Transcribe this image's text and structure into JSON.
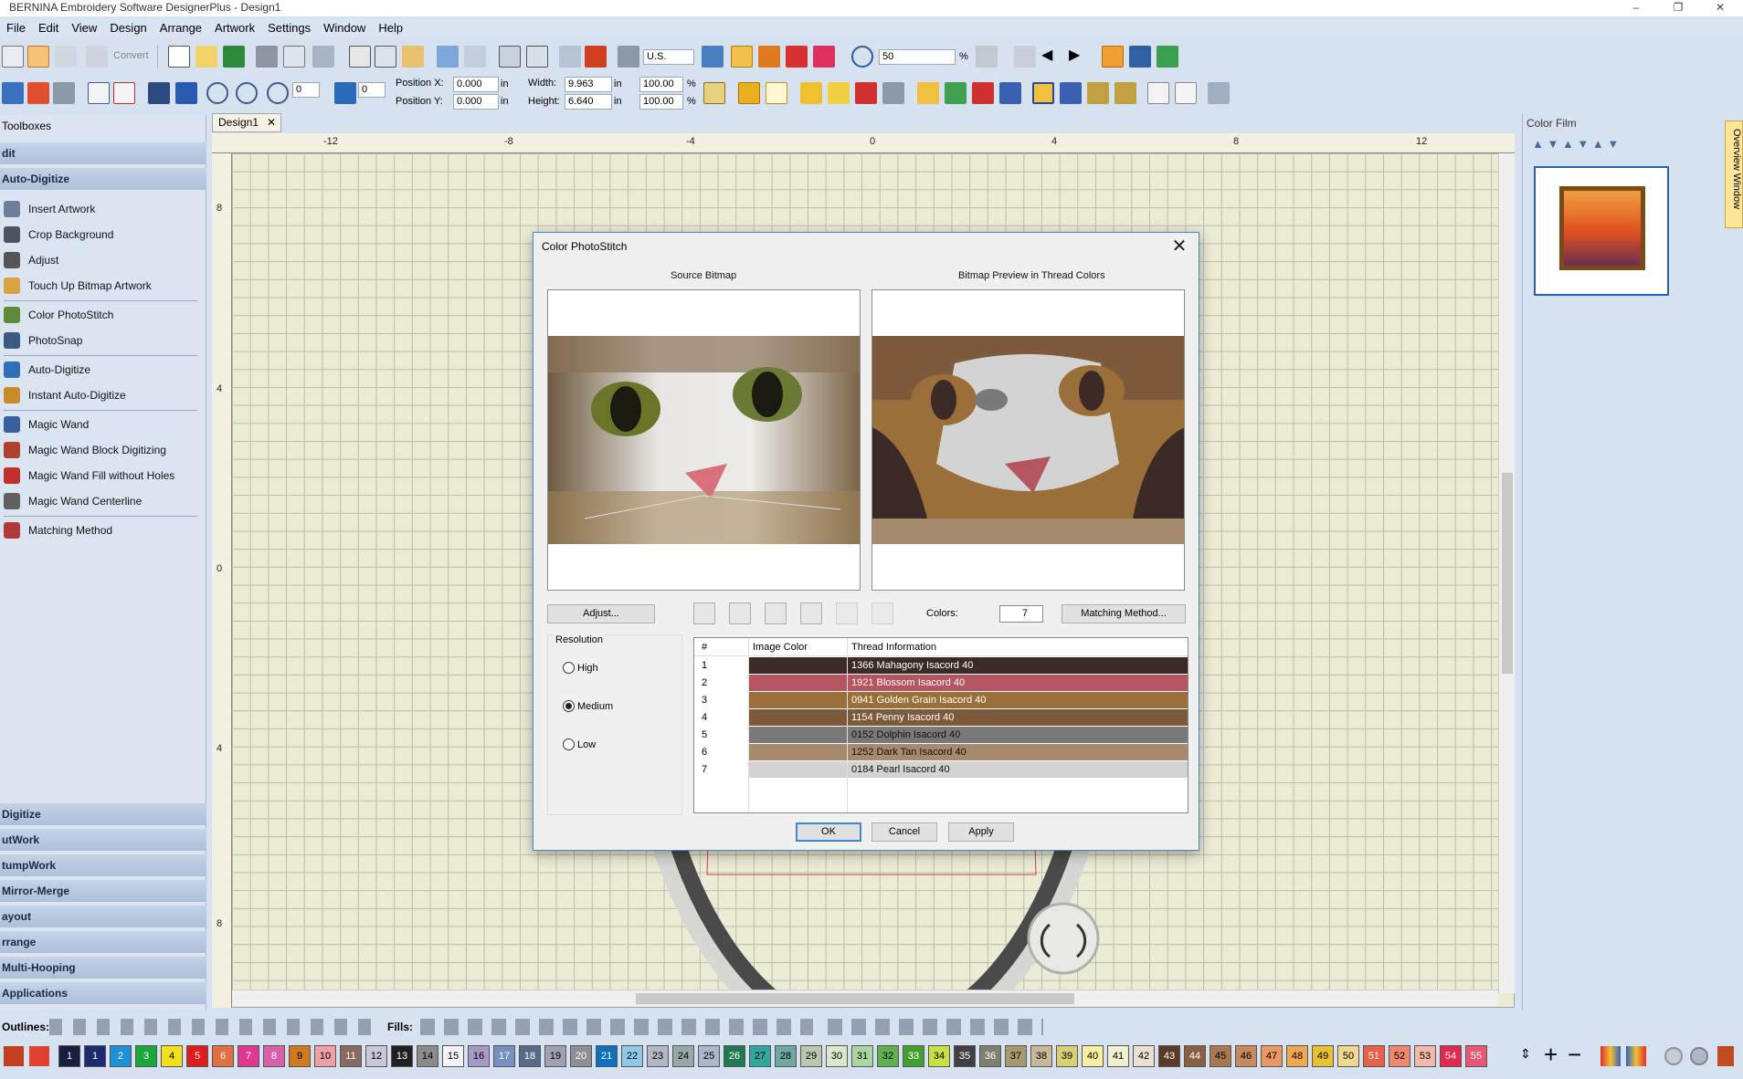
{
  "window": {
    "title": "BERNINA Embroidery Software DesignerPlus - Design1",
    "min": "–",
    "max": "❐",
    "close": "✕"
  },
  "menu": [
    "File",
    "Edit",
    "View",
    "Design",
    "Arrange",
    "Artwork",
    "Settings",
    "Window",
    "Help"
  ],
  "toolbar1": {
    "convert": "Convert",
    "units": "U.S.",
    "zoom": "50",
    "zoom_unit": "%"
  },
  "toolbar2": {
    "rotate1": "0",
    "rotate2": "0",
    "pos_x_label": "Position X:",
    "pos_x": "0.000",
    "pos_y_label": "Position Y:",
    "pos_y": "0.000",
    "unit_in": "in",
    "width_label": "Width:",
    "width": "9.963",
    "height_label": "Height:",
    "height": "6.640",
    "width_pct": "100.00",
    "height_pct": "100.00",
    "pct": "%"
  },
  "toolboxes": {
    "title": "Toolboxes",
    "sections_top": [
      "dit",
      "Auto-Digitize"
    ],
    "items": [
      {
        "label": "Insert Artwork",
        "icon": "insert-artwork-icon",
        "color": "#6b7f9a"
      },
      {
        "label": "Crop Background",
        "icon": "crop-icon",
        "color": "#4a5560"
      },
      {
        "label": "Adjust",
        "icon": "adjust-icon",
        "color": "#555"
      },
      {
        "label": "Touch Up Bitmap Artwork",
        "icon": "pencil-icon",
        "color": "#d9a441"
      },
      {
        "label": "Color PhotoStitch",
        "icon": "photostitch-icon",
        "color": "#5c8c3a"
      },
      {
        "label": "PhotoSnap",
        "icon": "camera-icon",
        "color": "#3c5a80"
      },
      {
        "label": "Auto-Digitize",
        "icon": "auto-digitize-icon",
        "color": "#2f6fb8"
      },
      {
        "label": "Instant Auto-Digitize",
        "icon": "instant-digitize-icon",
        "color": "#c98a2a"
      },
      {
        "label": "Magic Wand",
        "icon": "magic-wand-icon",
        "color": "#3a5fa0"
      },
      {
        "label": "Magic Wand Block Digitizing",
        "icon": "wand-block-icon",
        "color": "#b04030"
      },
      {
        "label": "Magic Wand Fill without Holes",
        "icon": "wand-fill-icon",
        "color": "#c0302a"
      },
      {
        "label": "Magic Wand Centerline",
        "icon": "wand-centerline-icon",
        "color": "#606060"
      },
      {
        "label": "Matching Method",
        "icon": "matching-method-icon",
        "color": "#b03a3a"
      }
    ],
    "sections_bottom": [
      "Digitize",
      "utWork",
      "tumpWork",
      "Mirror-Merge",
      "ayout",
      "rrange",
      "Multi-Hooping",
      "Applications"
    ]
  },
  "document": {
    "tab": "Design1",
    "tab_close": "✕",
    "ruler_top": [
      "-12",
      "-8",
      "-4",
      "0",
      "4",
      "8",
      "12"
    ],
    "ruler_left": [
      "8",
      "4",
      "0",
      "4",
      "8"
    ]
  },
  "color_film": {
    "title": "Color Film",
    "overview": "Overview Window"
  },
  "dialog": {
    "title": "Color PhotoStitch",
    "close": "✕",
    "source_title": "Source Bitmap",
    "preview_title": "Bitmap Preview in Thread Colors",
    "adjust": "Adjust...",
    "colors_label": "Colors:",
    "colors_value": "7",
    "matching": "Matching Method...",
    "resolution_title": "Resolution",
    "resolution": [
      {
        "label": "High",
        "selected": false
      },
      {
        "label": "Medium",
        "selected": true
      },
      {
        "label": "Low",
        "selected": false
      }
    ],
    "table_headers": [
      "#",
      "Image Color",
      "Thread Information"
    ],
    "threads": [
      {
        "n": "1",
        "info": "1366 Mahagony Isacord 40",
        "color": "#3b2a25",
        "text": "#ffffff"
      },
      {
        "n": "2",
        "info": "1921 Blossom Isacord 40",
        "color": "#b55560",
        "text": "#ffffff"
      },
      {
        "n": "3",
        "info": "0941 Golden Grain Isacord 40",
        "color": "#9a6f3a",
        "text": "#ffffff"
      },
      {
        "n": "4",
        "info": "1154 Penny Isacord 40",
        "color": "#7d5a3c",
        "text": "#ffffff"
      },
      {
        "n": "5",
        "info": "0152 Dolphin Isacord 40",
        "color": "#7a7878",
        "text": "#111111"
      },
      {
        "n": "6",
        "info": "1252 Dark Tan Isacord 40",
        "color": "#a68a6c",
        "text": "#111111"
      },
      {
        "n": "7",
        "info": "0184 Pearl Isacord 40",
        "color": "#d3d3d3",
        "text": "#111111"
      }
    ],
    "ok": "OK",
    "cancel": "Cancel",
    "apply": "Apply"
  },
  "bottom": {
    "outlines_label": "Outlines:",
    "fills_label": "Fills:",
    "palette": [
      {
        "n": "1",
        "c": "#1c1c3c",
        "t": "#fff"
      },
      {
        "n": "1",
        "c": "#1c2a6e",
        "t": "#fff"
      },
      {
        "n": "2",
        "c": "#1e90d8",
        "t": "#fff"
      },
      {
        "n": "3",
        "c": "#1aa63a",
        "t": "#fff"
      },
      {
        "n": "4",
        "c": "#f2e01c",
        "t": "#000"
      },
      {
        "n": "5",
        "c": "#e01c1c",
        "t": "#fff"
      },
      {
        "n": "6",
        "c": "#e07040",
        "t": "#fff"
      },
      {
        "n": "7",
        "c": "#e0388c",
        "t": "#fff"
      },
      {
        "n": "8",
        "c": "#d860a8",
        "t": "#fff"
      },
      {
        "n": "9",
        "c": "#d07a20",
        "t": "#000"
      },
      {
        "n": "10",
        "c": "#f0a0a8",
        "t": "#000"
      },
      {
        "n": "11",
        "c": "#8a6a60",
        "t": "#fff"
      },
      {
        "n": "12",
        "c": "#c8c8d8",
        "t": "#000"
      },
      {
        "n": "13",
        "c": "#202020",
        "t": "#fff"
      },
      {
        "n": "14",
        "c": "#8a8a8a",
        "t": "#000"
      },
      {
        "n": "15",
        "c": "#f4f4f4",
        "t": "#000"
      },
      {
        "n": "16",
        "c": "#a898c8",
        "t": "#000"
      },
      {
        "n": "17",
        "c": "#7890c0",
        "t": "#fff"
      },
      {
        "n": "18",
        "c": "#5a6a8a",
        "t": "#fff"
      },
      {
        "n": "19",
        "c": "#a0a0b0",
        "t": "#000"
      },
      {
        "n": "20",
        "c": "#8c9090",
        "t": "#fff"
      },
      {
        "n": "21",
        "c": "#1070c0",
        "t": "#fff"
      },
      {
        "n": "22",
        "c": "#90c8e8",
        "t": "#000"
      },
      {
        "n": "23",
        "c": "#b0b8c0",
        "t": "#000"
      },
      {
        "n": "24",
        "c": "#98a8a8",
        "t": "#000"
      },
      {
        "n": "25",
        "c": "#a8b8c8",
        "t": "#000"
      },
      {
        "n": "26",
        "c": "#207a50",
        "t": "#fff"
      },
      {
        "n": "27",
        "c": "#30a8a0",
        "t": "#000"
      },
      {
        "n": "28",
        "c": "#70a8a0",
        "t": "#000"
      },
      {
        "n": "29",
        "c": "#b8c8b0",
        "t": "#000"
      },
      {
        "n": "30",
        "c": "#d8e8c8",
        "t": "#000"
      },
      {
        "n": "31",
        "c": "#a8d8a0",
        "t": "#000"
      },
      {
        "n": "32",
        "c": "#60b050",
        "t": "#000"
      },
      {
        "n": "33",
        "c": "#40a030",
        "t": "#fff"
      },
      {
        "n": "34",
        "c": "#c8e040",
        "t": "#000"
      },
      {
        "n": "35",
        "c": "#404040",
        "t": "#fff"
      },
      {
        "n": "36",
        "c": "#808070",
        "t": "#fff"
      },
      {
        "n": "37",
        "c": "#a89870",
        "t": "#000"
      },
      {
        "n": "38",
        "c": "#c8b898",
        "t": "#000"
      },
      {
        "n": "39",
        "c": "#d8d070",
        "t": "#000"
      },
      {
        "n": "40",
        "c": "#f8f0a0",
        "t": "#000"
      },
      {
        "n": "41",
        "c": "#f0f0d0",
        "t": "#000"
      },
      {
        "n": "42",
        "c": "#e8e0d0",
        "t": "#000"
      },
      {
        "n": "43",
        "c": "#5a3a28",
        "t": "#fff"
      },
      {
        "n": "44",
        "c": "#8a6040",
        "t": "#fff"
      },
      {
        "n": "45",
        "c": "#a87850",
        "t": "#000"
      },
      {
        "n": "46",
        "c": "#c88860",
        "t": "#000"
      },
      {
        "n": "47",
        "c": "#e89860",
        "t": "#000"
      },
      {
        "n": "48",
        "c": "#f0a850",
        "t": "#000"
      },
      {
        "n": "49",
        "c": "#e8c030",
        "t": "#000"
      },
      {
        "n": "50",
        "c": "#f0d890",
        "t": "#000"
      },
      {
        "n": "51",
        "c": "#e86048",
        "t": "#fff"
      },
      {
        "n": "52",
        "c": "#f08870",
        "t": "#000"
      },
      {
        "n": "53",
        "c": "#f0b8a8",
        "t": "#000"
      },
      {
        "n": "54",
        "c": "#e02850",
        "t": "#fff"
      },
      {
        "n": "55",
        "c": "#e85870",
        "t": "#fff"
      }
    ]
  }
}
